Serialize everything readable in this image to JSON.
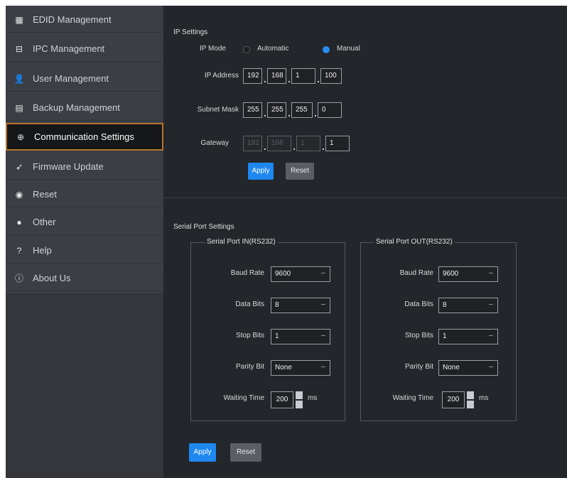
{
  "sidebar": {
    "items": [
      {
        "label": "EDID Management",
        "icon": "grid-icon"
      },
      {
        "label": "IPC Management",
        "icon": "ipc-icon"
      },
      {
        "label": "User Management",
        "icon": "user-icon"
      },
      {
        "label": "Backup Management",
        "icon": "backup-icon"
      },
      {
        "label": "Communication Settings",
        "icon": "globe-icon",
        "active": true
      },
      {
        "label": "Firmware Update",
        "icon": "rocket-icon"
      },
      {
        "label": "Reset",
        "icon": "reset-icon"
      },
      {
        "label": "Other",
        "icon": "other-icon"
      },
      {
        "label": "Help",
        "icon": "help-icon"
      },
      {
        "label": "About Us",
        "icon": "info-icon"
      }
    ]
  },
  "ip_settings": {
    "title": "IP Settings",
    "mode_label": "IP Mode",
    "mode_options": [
      "Automatic",
      "Manual"
    ],
    "mode_selected": "Manual",
    "ip_label": "IP Address",
    "ip": [
      "192",
      "168",
      "1",
      "100"
    ],
    "mask_label": "Subnet Mask",
    "mask": [
      "255",
      "255",
      "255",
      "0"
    ],
    "gateway_label": "Gateway",
    "gateway": [
      "192",
      "168",
      "1",
      "1"
    ],
    "apply": "Apply",
    "reset": "Reset"
  },
  "serial": {
    "title": "Serial Port Settings",
    "ports": [
      {
        "legend": "Serial Port IN(RS232)",
        "baud_label": "Baud Rate",
        "baud": "9600",
        "data_label": "Data Bits",
        "data": "8",
        "stop_label": "Stop Bits",
        "stop": "1",
        "parity_label": "Parity Bit",
        "parity": "None",
        "wait_label": "Waiting Time",
        "wait": "200",
        "unit": "ms"
      },
      {
        "legend": "Serial Port OUT(RS232)",
        "baud_label": "Baud Rate",
        "baud": "9600",
        "data_label": "Data Bits",
        "data": "8",
        "stop_label": "Stop Bits",
        "stop": "1",
        "parity_label": "Parity Bit",
        "parity": "None",
        "wait_label": "Waiting Time",
        "wait": "200",
        "unit": "ms"
      }
    ],
    "apply": "Apply",
    "reset": "Reset"
  },
  "colors": {
    "accent": "#1e87f0",
    "active_border": "#b8742e",
    "panel": "#23262b"
  }
}
